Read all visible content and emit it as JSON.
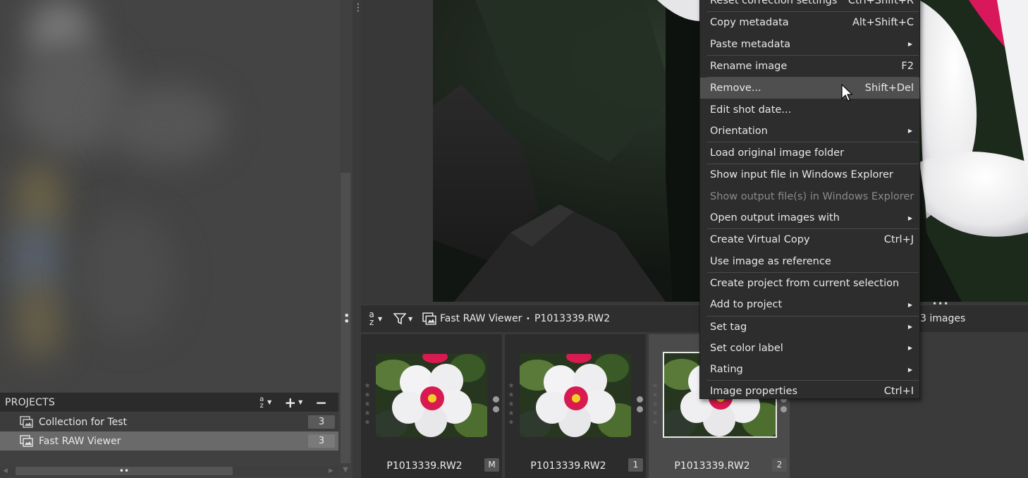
{
  "left_panel": {
    "projects_header": {
      "title": "PROJECTS",
      "sort_icon": "az-sort-icon",
      "add_icon": "plus-icon",
      "remove_icon": "minus-icon"
    },
    "projects": [
      {
        "label": "Collection for Test",
        "count": "3",
        "icon": "collection-icon",
        "selected": false
      },
      {
        "label": "Fast RAW Viewer",
        "count": "3",
        "icon": "collection-icon",
        "selected": true
      }
    ]
  },
  "toolbar": {
    "sort_icon": "az-sort-icon",
    "filter_icon": "filter-icon",
    "collection_name": "Fast RAW Viewer",
    "separator": "•",
    "current_file": "P1013339.RW2",
    "image_count": "3 images"
  },
  "thumbnails": [
    {
      "filename": "P1013339.RW2",
      "badge": "M",
      "selected": false
    },
    {
      "filename": "P1013339.RW2",
      "badge": "1",
      "selected": false
    },
    {
      "filename": "P1013339.RW2",
      "badge": "2",
      "selected": true
    }
  ],
  "context_menu": {
    "items": [
      {
        "label": "Reset correction settings",
        "shortcut": "Ctrl+Shift+R",
        "submenu": false,
        "disabled": false,
        "hover": false
      },
      {
        "label": "Copy metadata",
        "shortcut": "Alt+Shift+C",
        "submenu": false,
        "disabled": false,
        "hover": false
      },
      {
        "label": "Paste metadata",
        "shortcut": "",
        "submenu": true,
        "disabled": false,
        "hover": false
      },
      {
        "label": "Rename image",
        "shortcut": "F2",
        "submenu": false,
        "disabled": false,
        "hover": false
      },
      {
        "label": "Remove...",
        "shortcut": "Shift+Del",
        "submenu": false,
        "disabled": false,
        "hover": true
      },
      {
        "label": "Edit shot date...",
        "shortcut": "",
        "submenu": false,
        "disabled": false,
        "hover": false
      },
      {
        "label": "Orientation",
        "shortcut": "",
        "submenu": true,
        "disabled": false,
        "hover": false
      },
      {
        "label": "Load original image folder",
        "shortcut": "",
        "submenu": false,
        "disabled": false,
        "hover": false
      },
      {
        "label": "Show input file in Windows Explorer",
        "shortcut": "",
        "submenu": false,
        "disabled": false,
        "hover": false
      },
      {
        "label": "Show output file(s) in Windows Explorer",
        "shortcut": "",
        "submenu": false,
        "disabled": true,
        "hover": false
      },
      {
        "label": "Open output images with",
        "shortcut": "",
        "submenu": true,
        "disabled": false,
        "hover": false
      },
      {
        "label": "Create Virtual Copy",
        "shortcut": "Ctrl+J",
        "submenu": false,
        "disabled": false,
        "hover": false
      },
      {
        "label": "Use image as reference",
        "shortcut": "",
        "submenu": false,
        "disabled": false,
        "hover": false
      },
      {
        "label": "Create project from current selection",
        "shortcut": "",
        "submenu": false,
        "disabled": false,
        "hover": false
      },
      {
        "label": "Add to project",
        "shortcut": "",
        "submenu": true,
        "disabled": false,
        "hover": false
      },
      {
        "label": "Set tag",
        "shortcut": "",
        "submenu": true,
        "disabled": false,
        "hover": false
      },
      {
        "label": "Set color label",
        "shortcut": "",
        "submenu": true,
        "disabled": false,
        "hover": false
      },
      {
        "label": "Rating",
        "shortcut": "",
        "submenu": true,
        "disabled": false,
        "hover": false
      },
      {
        "label": "Image properties",
        "shortcut": "Ctrl+I",
        "submenu": false,
        "disabled": false,
        "hover": false
      }
    ],
    "separators_after": [
      0,
      2,
      3,
      6,
      7,
      10,
      12,
      14,
      17
    ]
  }
}
